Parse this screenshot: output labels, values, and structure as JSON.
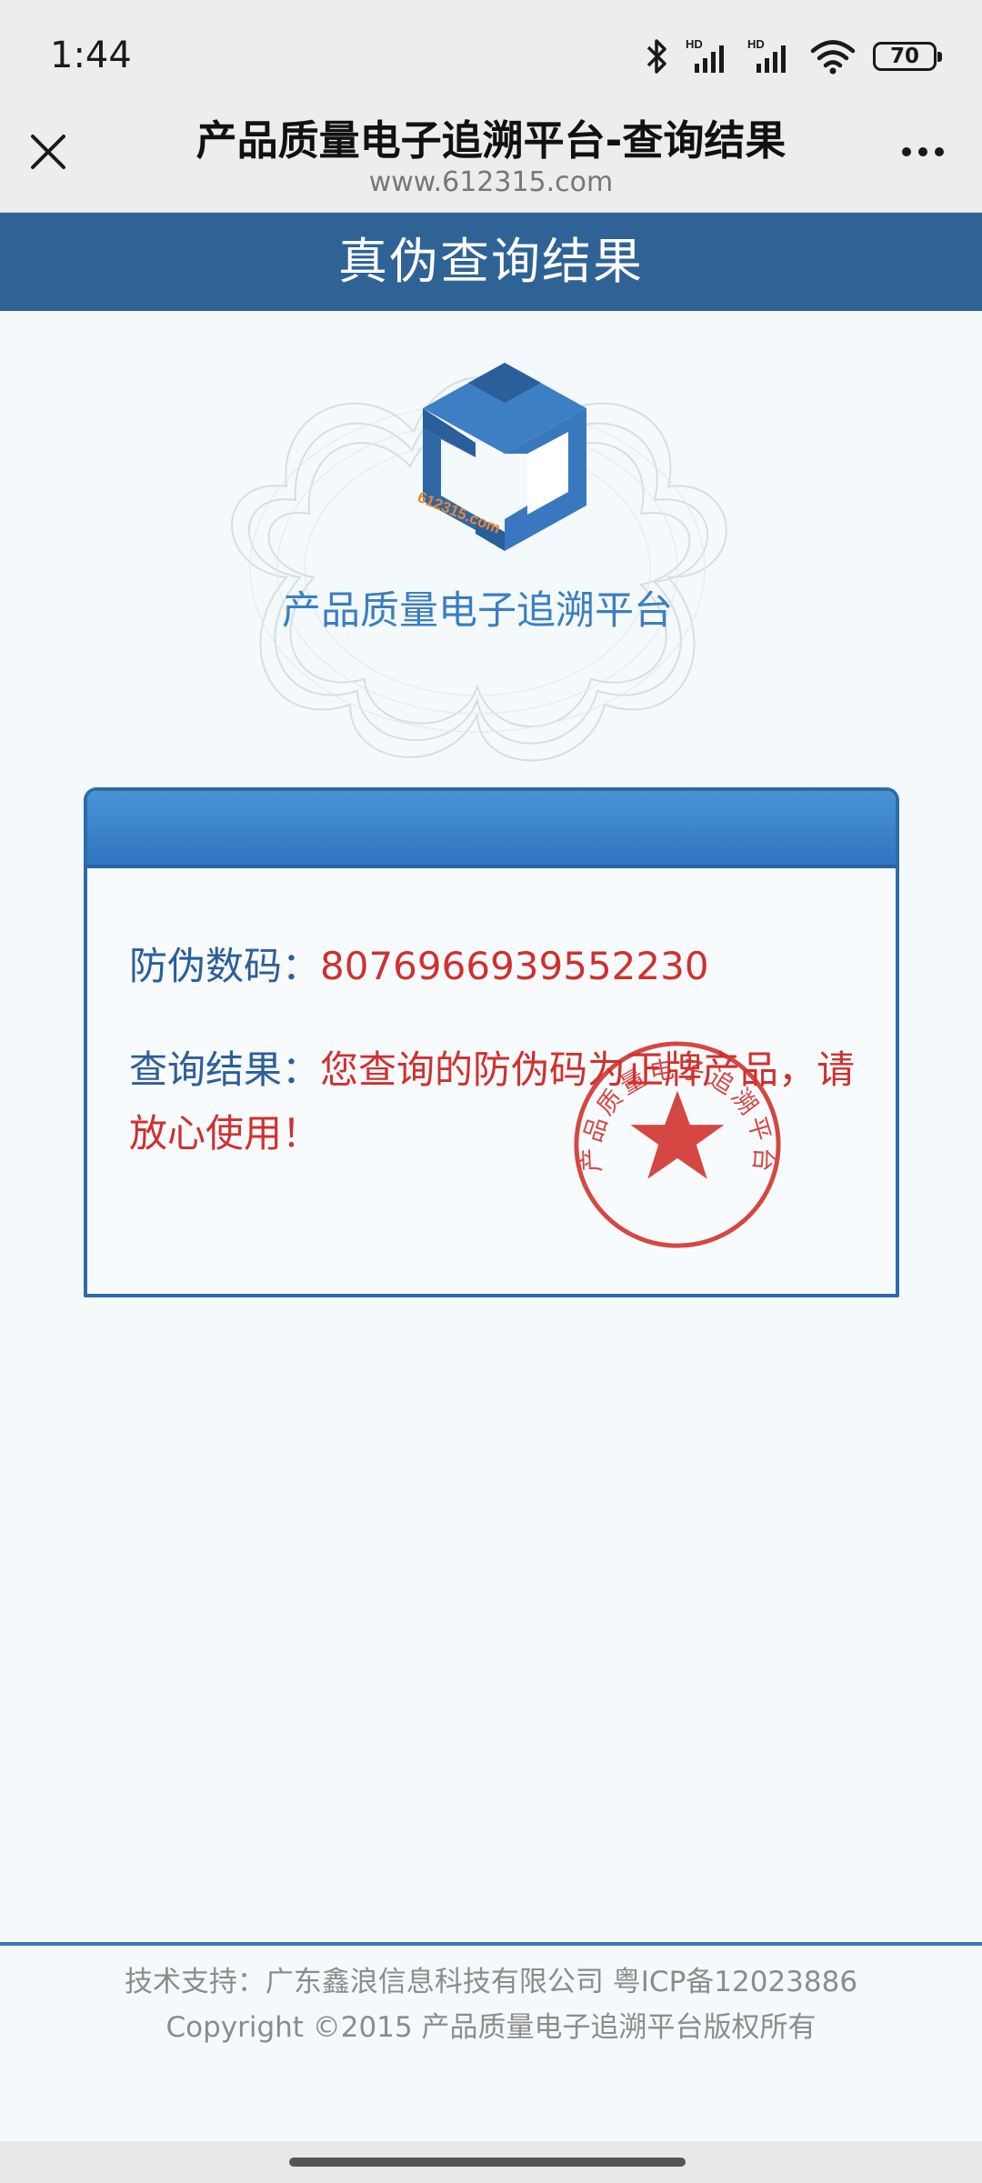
{
  "status_bar": {
    "time": "1:44",
    "battery": "70",
    "icons": [
      "bluetooth-icon",
      "signal-hd-icon",
      "signal-hd-icon",
      "wifi-icon",
      "battery-icon"
    ]
  },
  "nav": {
    "title": "产品质量电子追溯平台-查询结果",
    "url": "www.612315.com",
    "close_icon": "close-icon",
    "more_icon": "more-icon"
  },
  "header": {
    "title": "真伪查询结果"
  },
  "logo": {
    "badge_text": "612315.com",
    "caption": "产品质量电子追溯平台"
  },
  "result": {
    "code_label": "防伪数码：",
    "code_value": "8076966939552230",
    "result_label": "查询结果：",
    "result_value": "您查询的防伪码为正牌产品，请放心使用！",
    "seal_text": "产品质量电子追溯平台"
  },
  "footer": {
    "line1": "技术支持：广东鑫浪信息科技有限公司 粤ICP备12023886",
    "line2": "Copyright ©2015 产品质量电子追溯平台版权所有"
  },
  "colors": {
    "header_bg": "#2f6396",
    "accent_blue": "#2f6aa8",
    "value_red": "#d0302f",
    "label_blue": "#2c5e99",
    "page_bg": "#f4f9fc"
  }
}
